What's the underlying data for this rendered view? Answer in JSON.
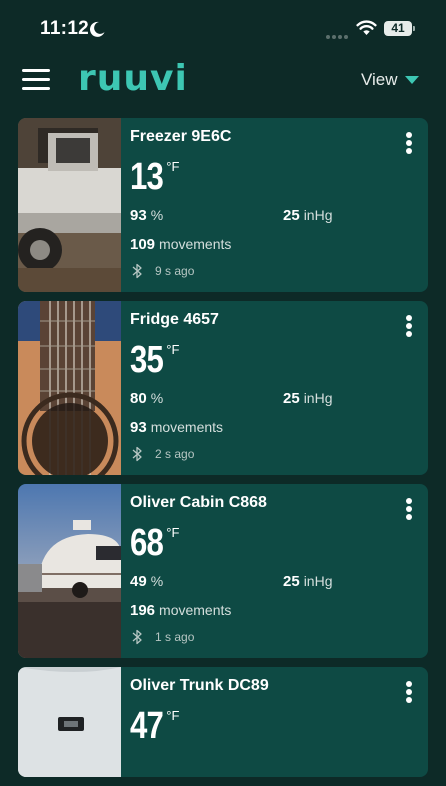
{
  "status_bar": {
    "time": "11:12",
    "battery": "41"
  },
  "header": {
    "logo": "ruuvi",
    "view_label": "View"
  },
  "cards": [
    {
      "name": "Freezer 9E6C",
      "temperature": "13",
      "temp_unit": "°F",
      "humidity": "93",
      "humidity_unit": "%",
      "pressure": "25",
      "pressure_unit": "inHg",
      "movements": "109",
      "movements_label": "movements",
      "updated": "9 s ago"
    },
    {
      "name": "Fridge 4657",
      "temperature": "35",
      "temp_unit": "°F",
      "humidity": "80",
      "humidity_unit": "%",
      "pressure": "25",
      "pressure_unit": "inHg",
      "movements": "93",
      "movements_label": "movements",
      "updated": "2 s ago"
    },
    {
      "name": "Oliver Cabin C868",
      "temperature": "68",
      "temp_unit": "°F",
      "humidity": "49",
      "humidity_unit": "%",
      "pressure": "25",
      "pressure_unit": "inHg",
      "movements": "196",
      "movements_label": "movements",
      "updated": "1 s ago"
    },
    {
      "name": "Oliver Trunk DC89",
      "temperature": "47",
      "temp_unit": "°F"
    }
  ],
  "colors": {
    "background": "#0d2a27",
    "card": "#0e4a44",
    "accent": "#3dc7b3"
  },
  "icons": [
    "moon-icon",
    "signal-icon",
    "wifi-icon",
    "menu-icon",
    "caret-down-icon",
    "kebab-menu-icon",
    "bluetooth-icon"
  ]
}
